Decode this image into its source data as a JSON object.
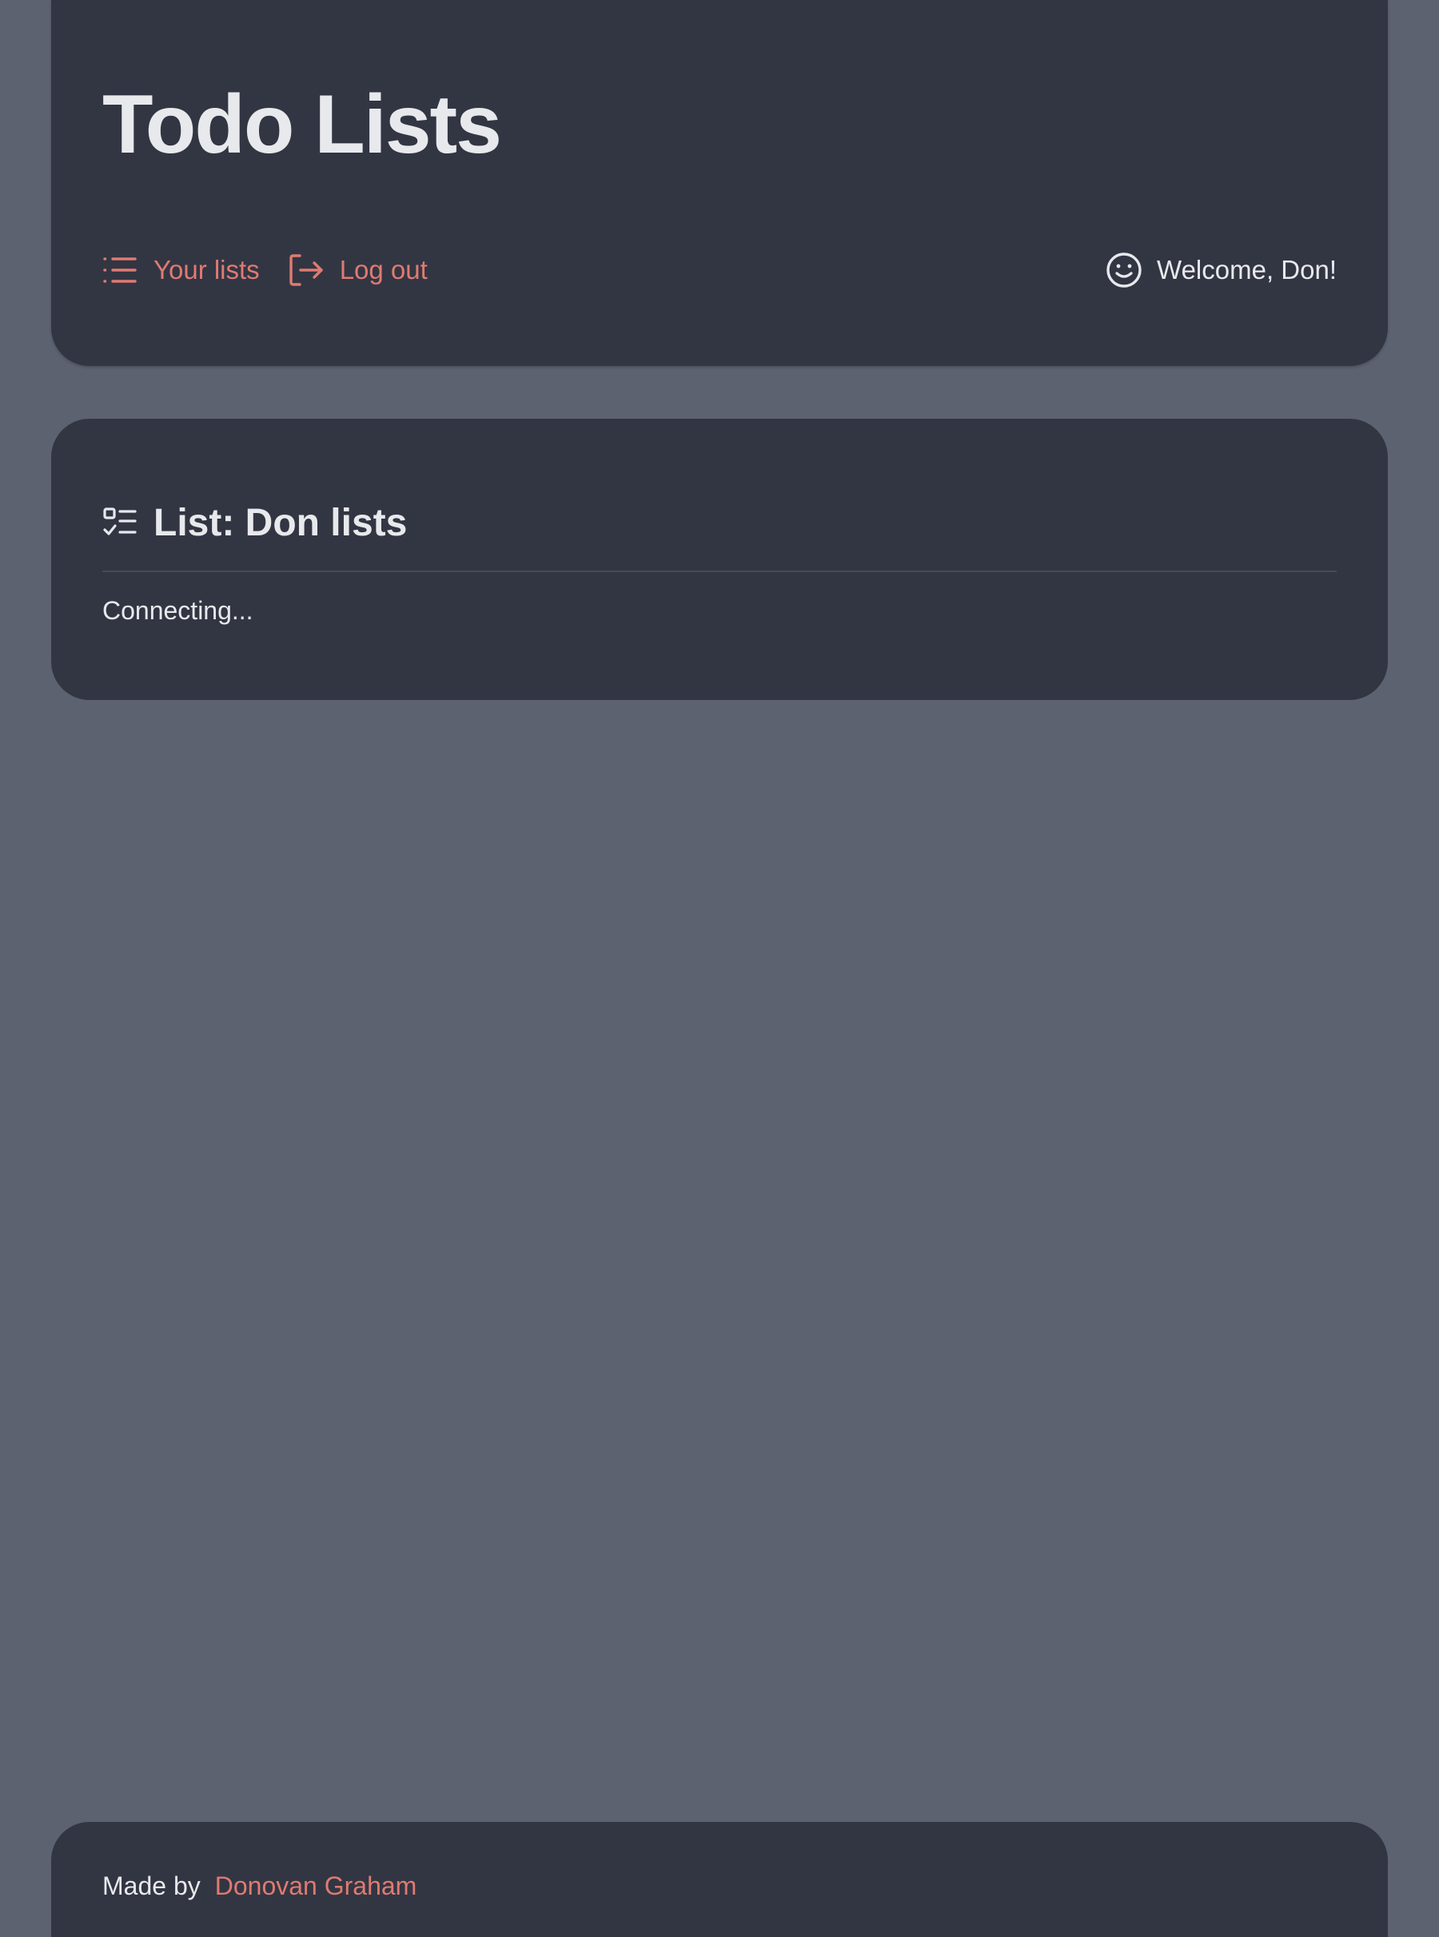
{
  "header": {
    "title": "Todo Lists",
    "nav": [
      {
        "label": "Your lists",
        "icon": "list-icon"
      },
      {
        "label": "Log out",
        "icon": "logout-icon"
      }
    ],
    "welcome": {
      "text": "Welcome, Don!",
      "icon": "smiley-icon"
    }
  },
  "list": {
    "heading": "List: Don lists",
    "heading_icon": "checklist-icon",
    "status": "Connecting..."
  },
  "footer": {
    "made_by": "Made by",
    "author": "Donovan Graham"
  },
  "colors": {
    "background": "#5c6270",
    "card": "#323643",
    "accent": "#e07a72",
    "text": "#e8e9ec"
  }
}
